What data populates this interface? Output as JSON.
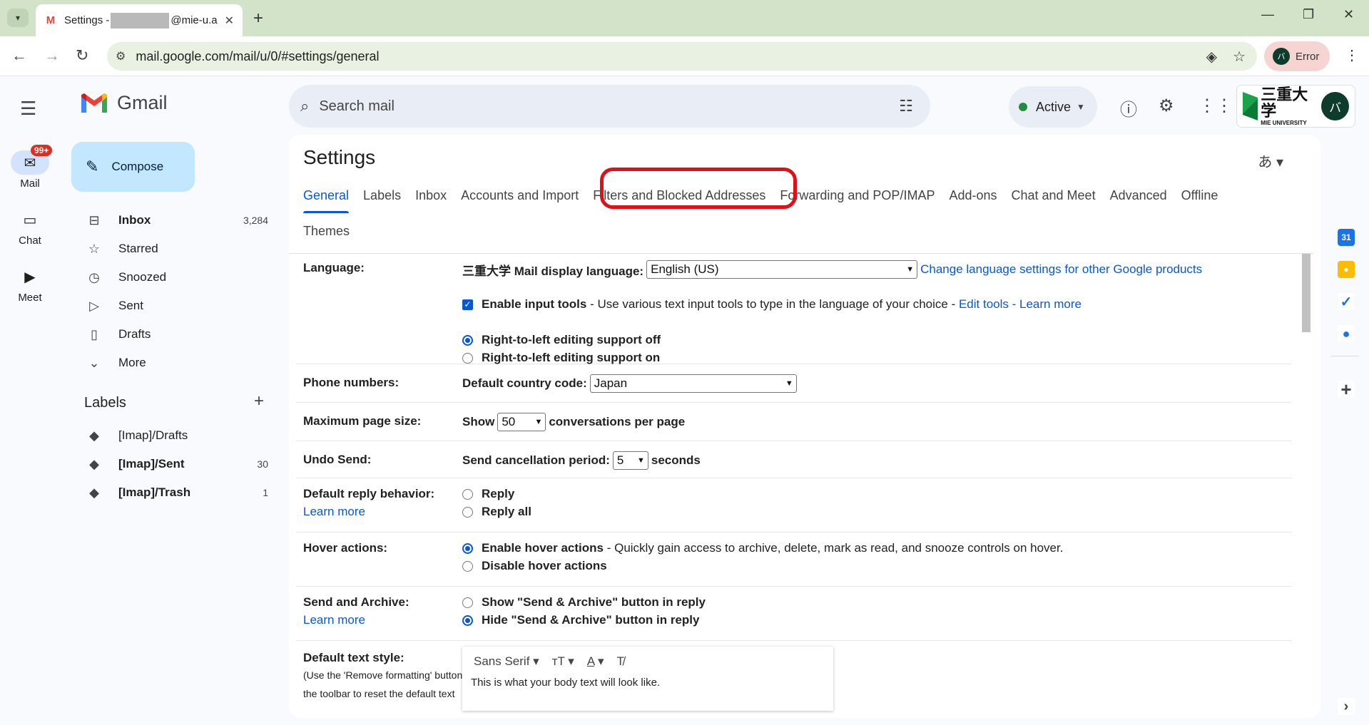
{
  "browser": {
    "tab_title_prefix": "Settings -",
    "tab_title_suffix": "@mie-u.a",
    "url": "mail.google.com/mail/u/0/#settings/general",
    "profile_label": "Error",
    "profile_initial": "バ"
  },
  "rail": {
    "items": [
      {
        "label": "Mail",
        "icon": "mail-icon",
        "badge": "99+"
      },
      {
        "label": "Chat",
        "icon": "chat-icon"
      },
      {
        "label": "Meet",
        "icon": "meet-icon"
      }
    ]
  },
  "brand": {
    "wordmark": "Gmail"
  },
  "compose_label": "Compose",
  "nav": [
    {
      "label": "Inbox",
      "count": "3,284",
      "bold": true,
      "icon": "inbox-icon"
    },
    {
      "label": "Starred",
      "count": "",
      "icon": "star-icon"
    },
    {
      "label": "Snoozed",
      "count": "",
      "icon": "clock-icon"
    },
    {
      "label": "Sent",
      "count": "",
      "icon": "send-icon"
    },
    {
      "label": "Drafts",
      "count": "",
      "icon": "draft-icon"
    },
    {
      "label": "More",
      "count": "",
      "icon": "chevron-down-icon"
    }
  ],
  "labels_heading": "Labels",
  "labels": [
    {
      "label": "[Imap]/Drafts",
      "count": "",
      "bold": false
    },
    {
      "label": "[Imap]/Sent",
      "count": "30",
      "bold": true
    },
    {
      "label": "[Imap]/Trash",
      "count": "1",
      "bold": true
    }
  ],
  "search": {
    "placeholder": "Search mail"
  },
  "status": {
    "label": "Active",
    "color": "#1e8e3e"
  },
  "account": {
    "org_text": "三重大学",
    "org_sub": "MIE UNIVERSITY",
    "initial": "バ"
  },
  "settings": {
    "title": "Settings",
    "input_tool_glyph": "あ",
    "tabs_row1": [
      "General",
      "Labels",
      "Inbox",
      "Accounts and Import",
      "Filters and Blocked Addresses",
      "Forwarding and POP/IMAP",
      "Add-ons",
      "Chat and Meet",
      "Advanced",
      "Offline"
    ],
    "tabs_row2": [
      "Themes"
    ],
    "active_tab": "General",
    "highlight_color": "#e0101b"
  },
  "general": {
    "language": {
      "label": "Language:",
      "display_label": "三重大学 Mail display language:",
      "display_value": "English (US)",
      "change_link": "Change language settings for other Google products",
      "input_tools_label": "Enable input tools",
      "input_tools_desc": " - Use various text input tools to type in the language of your choice - ",
      "edit_tools": "Edit tools",
      "sep": " - ",
      "learn_more": "Learn more",
      "rtl_off": "Right-to-left editing support off",
      "rtl_on": "Right-to-left editing support on"
    },
    "phone": {
      "label": "Phone numbers:",
      "country_label": "Default country code:",
      "country_value": "Japan"
    },
    "page_size": {
      "label": "Maximum page size:",
      "show": "Show",
      "value": "50",
      "suffix": "conversations per page"
    },
    "undo": {
      "label": "Undo Send:",
      "period_label": "Send cancellation period:",
      "value": "5",
      "suffix": "seconds"
    },
    "reply": {
      "label": "Default reply behavior:",
      "learn_more": "Learn more",
      "opt1": "Reply",
      "opt2": "Reply all"
    },
    "hover": {
      "label": "Hover actions:",
      "opt1": "Enable hover actions",
      "opt1_desc": " - Quickly gain access to archive, delete, mark as read, and snooze controls on hover.",
      "opt2": "Disable hover actions"
    },
    "send_archive": {
      "label": "Send and Archive:",
      "learn_more": "Learn more",
      "opt1": "Show \"Send & Archive\" button in reply",
      "opt2": "Hide \"Send & Archive\" button in reply"
    },
    "text_style": {
      "label": "Default text style:",
      "desc1": "(Use the 'Remove formatting' button on",
      "desc2": "the toolbar to reset the default text",
      "font": "Sans Serif",
      "preview": "This is what your body text will look like."
    }
  }
}
